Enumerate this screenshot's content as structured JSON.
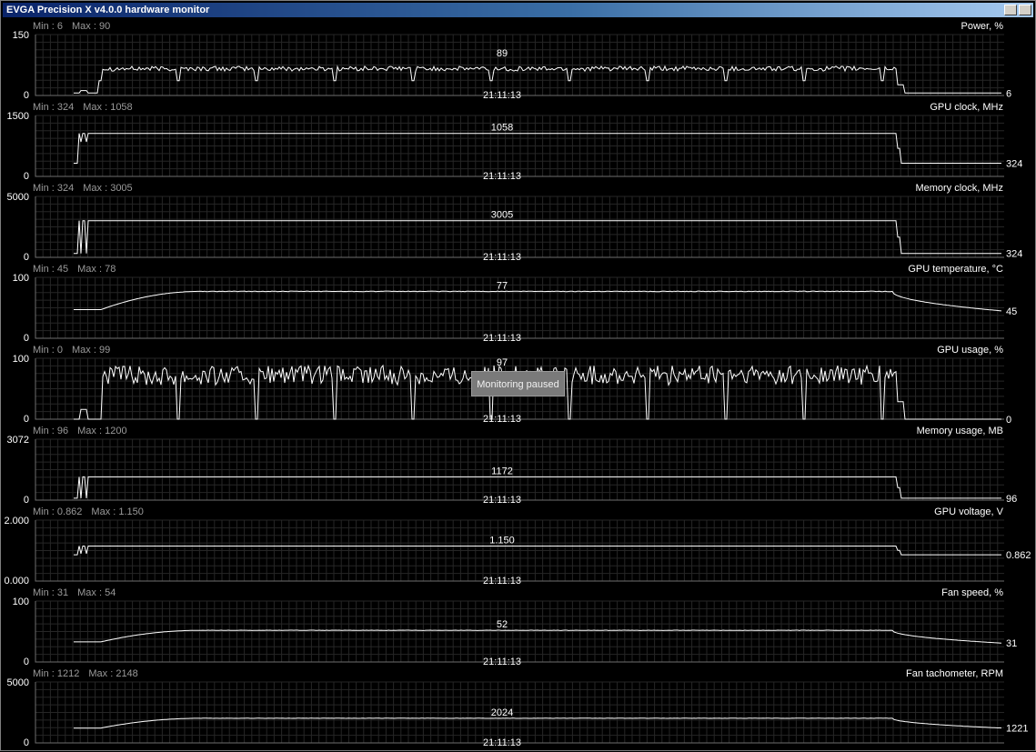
{
  "window": {
    "title": "EVGA Precision X v4.0.0 hardware monitor"
  },
  "timestamp": "21:11:13",
  "status": {
    "paused_label": "Monitoring paused"
  },
  "graphs": [
    {
      "key": "power",
      "label": "Power, %",
      "min_text": "Min : 6",
      "max_text": "Max : 90",
      "scale_top": "150",
      "scale_bottom": "0",
      "ymax": 150,
      "current": "89",
      "last": "6",
      "profile": "noisy",
      "base": 6,
      "plateau": 66,
      "noise": 6,
      "dips": 0
    },
    {
      "key": "gpu-clock",
      "label": "GPU clock, MHz",
      "min_text": "Min : 324",
      "max_text": "Max : 1058",
      "scale_top": "1500",
      "scale_bottom": "0",
      "ymax": 1500,
      "current": "1058",
      "last": "324",
      "profile": "step",
      "base": 324,
      "plateau": 1058,
      "spike": 850
    },
    {
      "key": "memory-clock",
      "label": "Memory clock, MHz",
      "min_text": "Min : 324",
      "max_text": "Max : 3005",
      "scale_top": "5000",
      "scale_bottom": "0",
      "ymax": 5000,
      "current": "3005",
      "last": "324",
      "profile": "step",
      "base": 324,
      "plateau": 3005,
      "spike": 324
    },
    {
      "key": "gpu-temperature",
      "label": "GPU temperature, °C",
      "min_text": "Min : 45",
      "max_text": "Max : 78",
      "scale_top": "100",
      "scale_bottom": "0",
      "ymax": 100,
      "current": "77",
      "last": "45",
      "profile": "smooth",
      "base": 47,
      "plateau": 77,
      "end": 45
    },
    {
      "key": "gpu-usage",
      "label": "GPU usage, %",
      "min_text": "Min : 0",
      "max_text": "Max : 99",
      "scale_top": "100",
      "scale_bottom": "0",
      "ymax": 100,
      "current": "97",
      "last": "0",
      "profile": "noisy",
      "base": 0,
      "plateau": 72,
      "noise": 16,
      "dips": 1
    },
    {
      "key": "memory-usage",
      "label": "Memory usage, MB",
      "min_text": "Min : 96",
      "max_text": "Max : 1200",
      "scale_top": "3072",
      "scale_bottom": "0",
      "ymax": 3072,
      "current": "1172",
      "last": "96",
      "profile": "step",
      "base": 96,
      "plateau": 1172,
      "spike": 96
    },
    {
      "key": "gpu-voltage",
      "label": "GPU voltage, V",
      "min_text": "Min : 0.862",
      "max_text": "Max : 1.150",
      "scale_top": "2.000",
      "scale_bottom": "0.000",
      "ymax": 2.0,
      "current": "1.150",
      "last": "0.862",
      "profile": "step",
      "base": 0.862,
      "plateau": 1.15,
      "spike": 0.9
    },
    {
      "key": "fan-speed",
      "label": "Fan speed, %",
      "min_text": "Min : 31",
      "max_text": "Max : 54",
      "scale_top": "100",
      "scale_bottom": "0",
      "ymax": 100,
      "current": "52",
      "last": "31",
      "profile": "smooth",
      "base": 33,
      "plateau": 52,
      "end": 31
    },
    {
      "key": "fan-tachometer",
      "label": "Fan tachometer, RPM",
      "min_text": "Min : 1212",
      "max_text": "Max : 2148",
      "scale_top": "5000",
      "scale_bottom": "0",
      "ymax": 5000,
      "current": "2024",
      "last": "1221",
      "profile": "smooth",
      "base": 1220,
      "plateau": 2024,
      "end": 1221
    }
  ],
  "colors": {
    "background": "#000000",
    "grid": "#262626",
    "axis": "#6e6e6e",
    "trace": "#ffffff",
    "text": "#ffffff",
    "dim_text": "#9a9a9a"
  }
}
